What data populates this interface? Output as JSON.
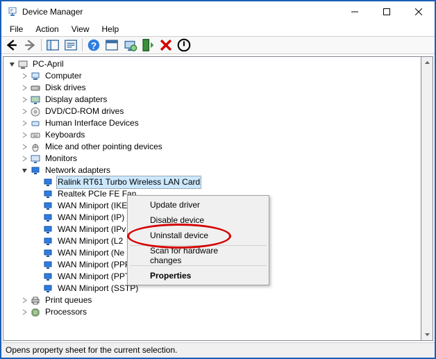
{
  "window": {
    "title": "Device Manager"
  },
  "menu": {
    "file": "File",
    "action": "Action",
    "view": "View",
    "help": "Help"
  },
  "tree": {
    "root": "PC-April",
    "nodes": {
      "computer": "Computer",
      "disk": "Disk drives",
      "display": "Display adapters",
      "dvd": "DVD/CD-ROM drives",
      "hid": "Human Interface Devices",
      "keyboards": "Keyboards",
      "mice": "Mice and other pointing devices",
      "monitors": "Monitors",
      "network": "Network adapters",
      "print": "Print queues",
      "processors": "Processors"
    },
    "adapters": {
      "a0": "Ralink RT61 Turbo Wireless LAN Card",
      "a1": "Realtek PCIe FE Fan",
      "a2": "WAN Miniport (IKE",
      "a3": "WAN Miniport (IP)",
      "a4": "WAN Miniport (IPv",
      "a5": "WAN Miniport (L2",
      "a6": "WAN Miniport (Ne",
      "a7": "WAN Miniport (PPPOE)",
      "a8": "WAN Miniport (PPTP)",
      "a9": "WAN Miniport (SSTP)"
    }
  },
  "context": {
    "update": "Update driver",
    "disable": "Disable device",
    "uninstall": "Uninstall device",
    "scan": "Scan for hardware changes",
    "properties": "Properties"
  },
  "status": {
    "text": "Opens property sheet for the current selection."
  }
}
